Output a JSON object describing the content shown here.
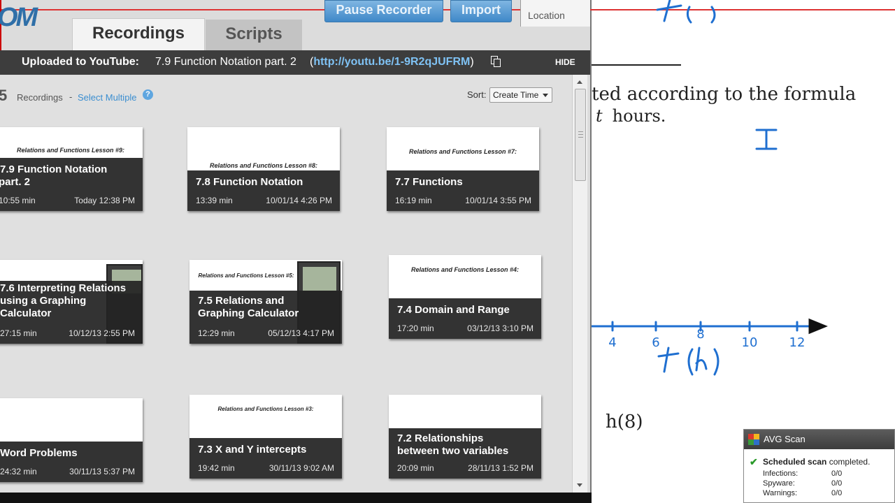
{
  "app": {
    "top_buttons": {
      "pause_recorder": "Pause Recorder",
      "import": "Import",
      "location": "Location"
    },
    "tabs": {
      "recordings": "Recordings",
      "scripts": "Scripts"
    },
    "banner": {
      "label": "Uploaded to YouTube:",
      "title": "7.9 Function Notation part. 2",
      "url_open": "(",
      "url": "http://youtu.be/1-9R2qJUFRM",
      "url_close": ")",
      "hide": "HIDE"
    },
    "list_header": {
      "count": "5",
      "recordings_label": "Recordings",
      "separator": "-",
      "select_multiple": "Select Multiple",
      "help": "?",
      "sort_label": "Sort:",
      "sort_value": "Create Time"
    },
    "recordings": [
      {
        "title_1": "7.9 Function Notation",
        "title_2": "part. 2",
        "duration": "10:55 min",
        "date": "Today 12:38 PM",
        "thumb_title": "Relations and Functions Lesson #9:"
      },
      {
        "title_1": "7.8 Function Notation",
        "title_2": "",
        "duration": "13:39 min",
        "date": "10/01/14 4:26 PM",
        "thumb_title": "Relations and Functions Lesson #8:"
      },
      {
        "title_1": "7.7 Functions",
        "title_2": "",
        "duration": "16:19 min",
        "date": "10/01/14 3:55 PM",
        "thumb_title": "Relations and Functions Lesson #7:"
      },
      {
        "title_1": "7.6 Interpreting Relations",
        "title_2": "using a Graphing",
        "title_3": "Calculator",
        "duration": "27:15 min",
        "date": "10/12/13 2:55 PM",
        "thumb_title": ""
      },
      {
        "title_1": "7.5 Relations and",
        "title_2": "Graphing Calculator",
        "duration": "12:29 min",
        "date": "05/12/13 4:17 PM",
        "thumb_title": "Relations and Functions Lesson #5:"
      },
      {
        "title_1": "7.4 Domain and Range",
        "title_2": "",
        "duration": "17:20 min",
        "date": "03/12/13 3:10 PM",
        "thumb_title": "Relations and Functions Lesson #4:"
      },
      {
        "title_1": "Word Problems",
        "title_2": "",
        "duration": "24:32 min",
        "date": "30/11/13 5:37 PM",
        "thumb_title": ""
      },
      {
        "title_1": "7.3 X and Y intercepts",
        "title_2": "",
        "duration": "19:42 min",
        "date": "30/11/13 9:02 AM",
        "thumb_title": "Relations and Functions Lesson #3:"
      },
      {
        "title_1": "7.2 Relationships",
        "title_2": "between two variables",
        "duration": "20:09 min",
        "date": "28/11/13 1:52 PM",
        "thumb_title": ""
      }
    ]
  },
  "document": {
    "formula_line": "ted according to the formula",
    "hours_var": "t",
    "hours_line": "hours.",
    "h8": "h(8)",
    "handwriting": {
      "I": "I",
      "t_h": "t (h)",
      "ticks": [
        "4",
        "6",
        "8",
        "10",
        "12"
      ],
      "top": "t (t)"
    }
  },
  "avg": {
    "title": "AVG Scan",
    "status_bold": "Scheduled scan",
    "status_rest": "completed.",
    "rows": [
      {
        "label": "Infections:",
        "value": "0/0"
      },
      {
        "label": "Spyware:",
        "value": "0/0"
      },
      {
        "label": "Warnings:",
        "value": "0/0"
      }
    ]
  },
  "colors": {
    "accent_blue": "#3b8ed0",
    "banner_bg": "#3d3d3d",
    "handwriting_blue": "#1f6fd0",
    "avg_green": "#2a9a2a"
  }
}
